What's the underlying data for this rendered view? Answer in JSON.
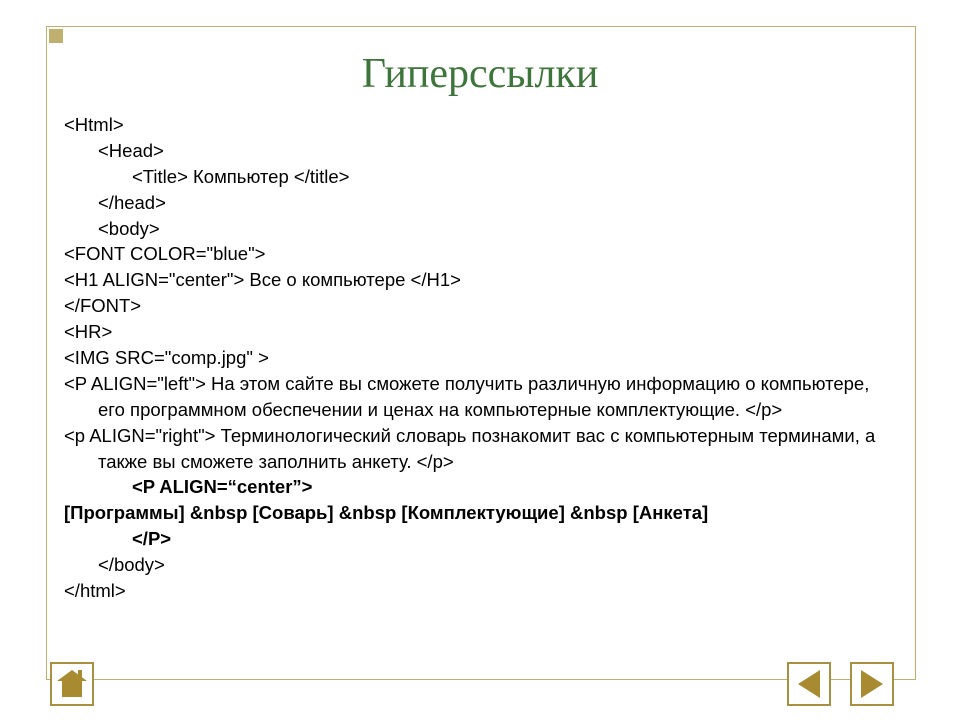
{
  "title": "Гиперссылки",
  "code": {
    "l1": "<Html>",
    "l2": "<Head>",
    "l3": "<Title> Компьютер </title>",
    "l4": "</head>",
    "l5": "<body>",
    "l6": "<FONT COLOR=\"blue\">",
    "l7": "<H1 ALIGN=\"center\"> Все о компьютере </H1>",
    "l8": "</FONT>",
    "l9": "<HR>",
    "l10": "<IMG SRC=\"comp.jpg\" >",
    "l11": "<P ALIGN=\"left\"> На этом сайте вы сможете получить различную информацию о компьютере, его программном обеспечении и ценах на компьютерные комплектующие. </p>",
    "l12": "<p ALIGN=\"right\"> Терминологический словарь познакомит вас с компьютерным терминами, а также вы сможете заполнить анкету. </p>",
    "l13": "<P ALIGN=“center”>",
    "l14": "[Программы] &nbsp [Соварь] &nbsp [Комплектующие] &nbsp [Анкета]",
    "l15": "</P>",
    "l16": "</body>",
    "l17": "</html>"
  },
  "nav": {
    "home": "home",
    "prev": "previous-slide",
    "next": "next-slide"
  }
}
